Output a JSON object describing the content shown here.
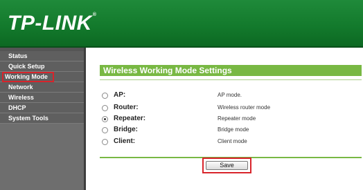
{
  "header": {
    "logo_text": "TP-LINK",
    "logo_mark": "®"
  },
  "sidebar": {
    "items": [
      {
        "label": "Status"
      },
      {
        "label": "Quick Setup"
      },
      {
        "label": "Working Mode"
      },
      {
        "label": "Network"
      },
      {
        "label": "Wireless"
      },
      {
        "label": "DHCP"
      },
      {
        "label": "System Tools"
      }
    ],
    "active_index": 2
  },
  "main": {
    "title": "Wireless Working Mode Settings",
    "options": [
      {
        "label": "AP:",
        "desc": "AP mode.",
        "checked": false
      },
      {
        "label": "Router:",
        "desc": "Wireless router mode",
        "checked": false
      },
      {
        "label": "Repeater:",
        "desc": "Repeater mode",
        "checked": true
      },
      {
        "label": "Bridge:",
        "desc": "Bridge mode",
        "checked": false
      },
      {
        "label": "Client:",
        "desc": "Client mode",
        "checked": false
      }
    ],
    "save_label": "Save"
  },
  "colors": {
    "header_green": "#137a2c",
    "title_green": "#78b843",
    "highlight_red": "#d8242b",
    "sidebar_gray": "#5f5f5f"
  }
}
